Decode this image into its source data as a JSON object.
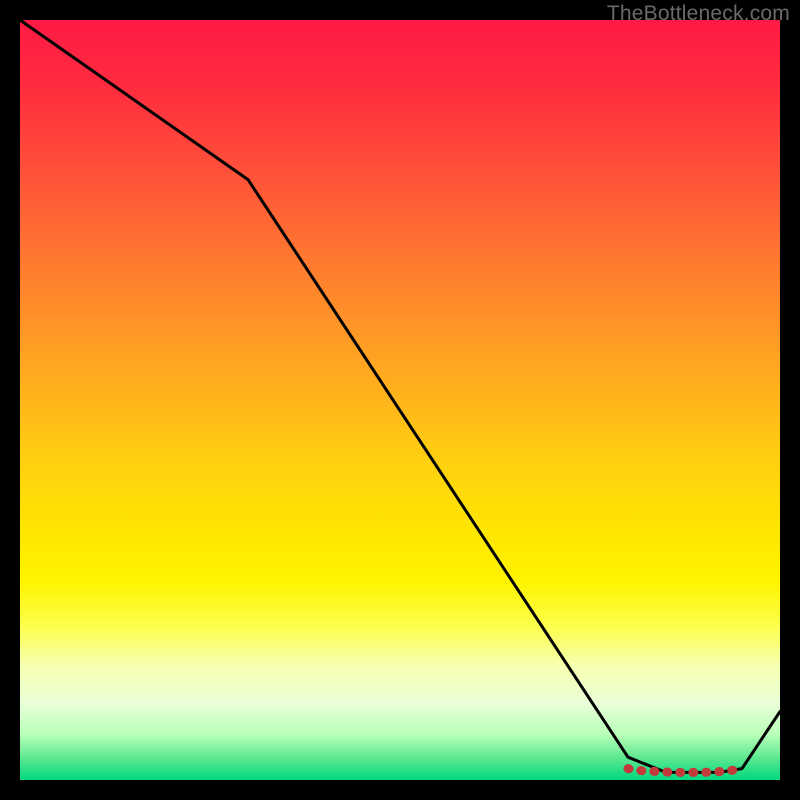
{
  "watermark": "TheBottleneck.com",
  "chart_data": {
    "type": "line",
    "title": "",
    "xlabel": "",
    "ylabel": "",
    "xlim": [
      0,
      100
    ],
    "ylim": [
      0,
      100
    ],
    "grid": false,
    "background_gradient": [
      "#ff1a45",
      "#ff7a30",
      "#ffe800",
      "#00d880"
    ],
    "series": [
      {
        "name": "black-curve",
        "color": "#000000",
        "x": [
          0,
          30,
          80,
          85,
          88,
          92,
          95,
          100
        ],
        "values": [
          100,
          79,
          3,
          1,
          1,
          1,
          1.5,
          9
        ]
      },
      {
        "name": "red-marker-band",
        "color": "#c23a3a",
        "x": [
          80,
          82,
          84,
          86,
          88,
          90,
          92,
          94,
          95
        ],
        "values": [
          1.5,
          1.2,
          1.1,
          1.0,
          1.0,
          1.0,
          1.1,
          1.3,
          1.5
        ]
      }
    ]
  }
}
